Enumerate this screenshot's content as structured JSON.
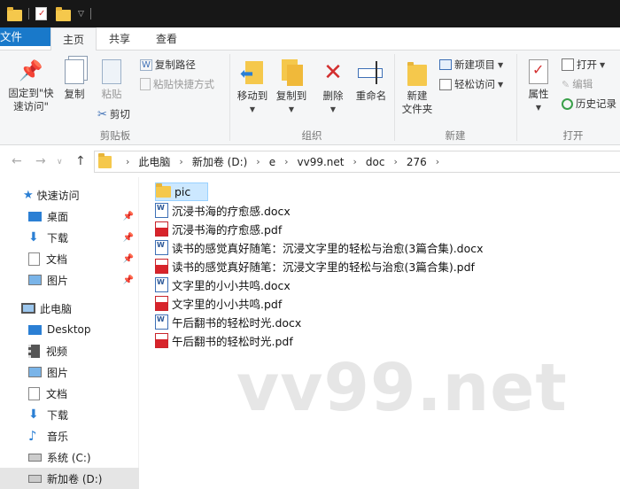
{
  "ribbon_tabs": [
    "文件",
    "主页",
    "共享",
    "查看"
  ],
  "clipboard": {
    "pin": [
      "固定到\"快",
      "速访问\""
    ],
    "copy": "复制",
    "paste": "粘贴",
    "copy_path": "复制路径",
    "paste_shortcut": "粘贴快捷方式",
    "cut": "剪切",
    "label": "剪贴板"
  },
  "organize": {
    "move_to": "移动到",
    "copy_to": "复制到",
    "delete": "删除",
    "rename": "重命名",
    "label": "组织"
  },
  "new_group": {
    "new_folder": [
      "新建",
      "文件夹"
    ],
    "new_item": "新建项目",
    "easy_access": "轻松访问",
    "label": "新建"
  },
  "open_group": {
    "properties": "属性",
    "open": "打开",
    "edit": "编辑",
    "history": "历史记录",
    "label": "打开"
  },
  "breadcrumb": [
    "此电脑",
    "新加卷 (D:)",
    "e",
    "vv99.net",
    "doc",
    "276"
  ],
  "nav": {
    "quick_access": "快速访问",
    "quick_items": [
      "桌面",
      "下载",
      "文档",
      "图片"
    ],
    "this_pc": "此电脑",
    "pc_items": [
      "Desktop",
      "视频",
      "图片",
      "文档",
      "下载",
      "音乐",
      "系统 (C:)",
      "新加卷 (D:)"
    ]
  },
  "files": [
    {
      "name": "pic",
      "type": "folder"
    },
    {
      "name": "沉浸书海的疗愈感.docx",
      "type": "docx"
    },
    {
      "name": "沉浸书海的疗愈感.pdf",
      "type": "pdf"
    },
    {
      "name": "读书的感觉真好随笔：沉浸文字里的轻松与治愈(3篇合集).docx",
      "type": "docx"
    },
    {
      "name": "读书的感觉真好随笔：沉浸文字里的轻松与治愈(3篇合集).pdf",
      "type": "pdf"
    },
    {
      "name": "文字里的小小共鸣.docx",
      "type": "docx"
    },
    {
      "name": "文字里的小小共鸣.pdf",
      "type": "pdf"
    },
    {
      "name": "午后翻书的轻松时光.docx",
      "type": "docx"
    },
    {
      "name": "午后翻书的轻松时光.pdf",
      "type": "pdf"
    }
  ],
  "watermark": "vv99.net",
  "colors": {
    "accent": "#1979ca",
    "folder": "#f5c84c",
    "delete_red": "#d32f2f",
    "selection": "#cce8ff"
  }
}
